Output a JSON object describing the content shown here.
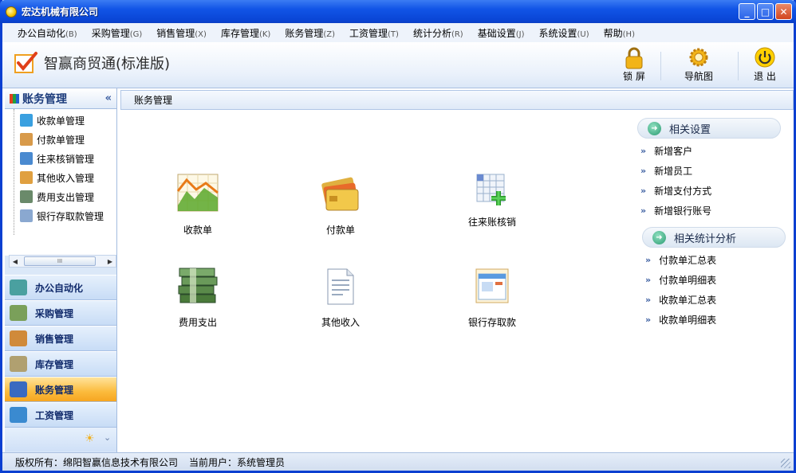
{
  "window": {
    "title": "宏达机械有限公司",
    "min_label": "_",
    "max_label": "□",
    "close_label": "✕"
  },
  "menu": [
    {
      "label": "办公自动化",
      "key": "(B)"
    },
    {
      "label": "采购管理",
      "key": "(G)"
    },
    {
      "label": "销售管理",
      "key": "(X)"
    },
    {
      "label": "库存管理",
      "key": "(K)"
    },
    {
      "label": "账务管理",
      "key": "(Z)"
    },
    {
      "label": "工资管理",
      "key": "(T)"
    },
    {
      "label": "统计分析",
      "key": "(R)"
    },
    {
      "label": "基础设置",
      "key": "(J)"
    },
    {
      "label": "系统设置",
      "key": "(U)"
    },
    {
      "label": "帮助",
      "key": "(H)"
    }
  ],
  "toolbar": {
    "app_name": "智赢商贸通(标准版)",
    "lock_label": "锁 屏",
    "nav_label": "导航图",
    "exit_label": "退 出"
  },
  "sidebar": {
    "title": "账务管理",
    "collapse": "«",
    "tree": [
      {
        "label": "收款单管理",
        "color": "#3aa0e0"
      },
      {
        "label": "付款单管理",
        "color": "#d89a4a"
      },
      {
        "label": "往来核销管理",
        "color": "#4a8ad0"
      },
      {
        "label": "其他收入管理",
        "color": "#e0a040"
      },
      {
        "label": "费用支出管理",
        "color": "#6a8a6a"
      },
      {
        "label": "银行存取款管理",
        "color": "#8aa8d0"
      }
    ],
    "scroll_thumb": "III",
    "modules": [
      {
        "label": "办公自动化",
        "color": "#4aa0a0"
      },
      {
        "label": "采购管理",
        "color": "#7aa05a"
      },
      {
        "label": "销售管理",
        "color": "#d08a3a"
      },
      {
        "label": "库存管理",
        "color": "#b0a070"
      },
      {
        "label": "账务管理",
        "color": "#3a6ac0"
      },
      {
        "label": "工资管理",
        "color": "#3a8ad0"
      }
    ],
    "footer_icon": "☀",
    "footer_arrow": "⌄"
  },
  "content": {
    "breadcrumb": "账务管理",
    "icons": [
      {
        "label": "收款单"
      },
      {
        "label": "付款单"
      },
      {
        "label": "往来账核销"
      },
      {
        "label": "费用支出"
      },
      {
        "label": "其他收入"
      },
      {
        "label": "银行存取款"
      }
    ]
  },
  "panel_settings": {
    "title": "相关设置",
    "links": [
      "新增客户",
      "新增员工",
      "新增支付方式",
      "新增银行账号"
    ]
  },
  "panel_stats": {
    "title": "相关统计分析",
    "links": [
      "付款单汇总表",
      "付款单明细表",
      "收款单汇总表",
      "收款单明细表"
    ]
  },
  "status": {
    "copyright": "版权所有：绵阳智赢信息技术有限公司",
    "user": "当前用户：系统管理员"
  }
}
